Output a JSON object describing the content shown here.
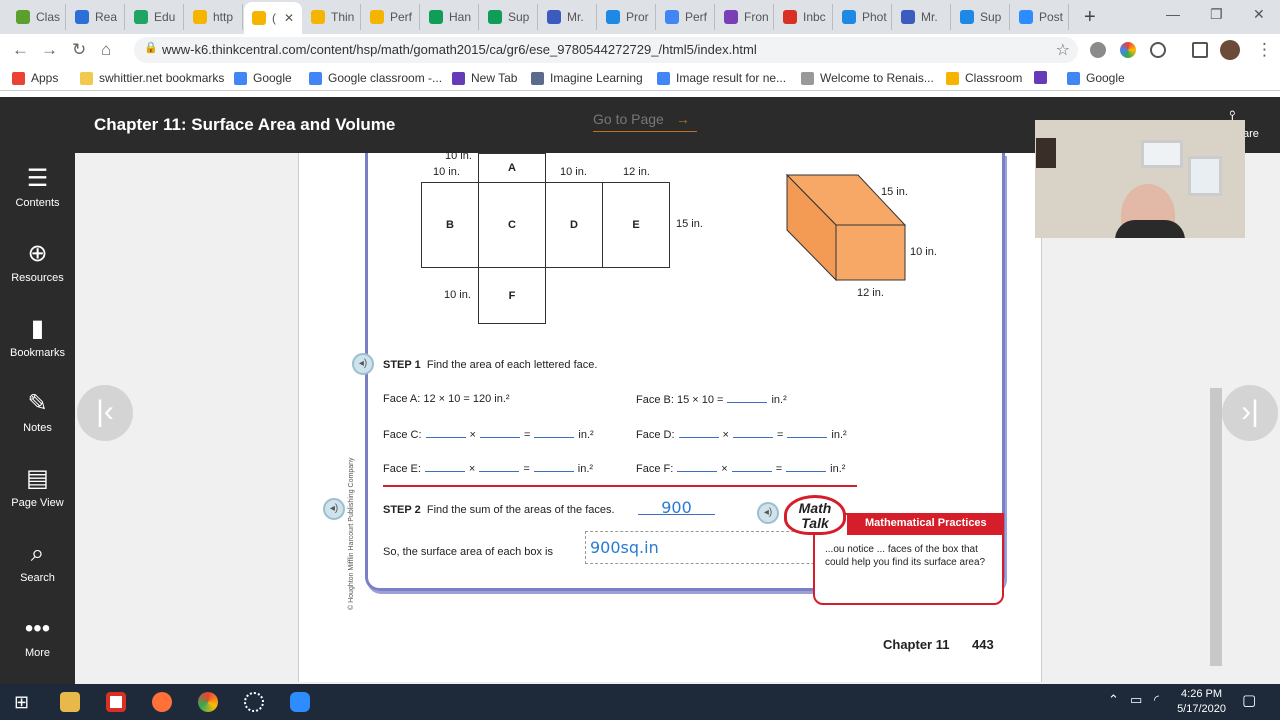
{
  "browser": {
    "tabs": [
      {
        "label": "Clas",
        "color": "#5aa02c"
      },
      {
        "label": "Rea",
        "color": "#2c6fd6"
      },
      {
        "label": "Edu",
        "color": "#1fa463"
      },
      {
        "label": "http",
        "color": "#f4b400"
      },
      {
        "label": "(",
        "color": "#f4b400"
      },
      {
        "label": "Thin",
        "color": "#f4b400"
      },
      {
        "label": "Perf",
        "color": "#f4b400"
      },
      {
        "label": "Han",
        "color": "#0f9d58"
      },
      {
        "label": "Sup",
        "color": "#0f9d58"
      },
      {
        "label": "Mr.",
        "color": "#3b5bbf"
      },
      {
        "label": "Pror",
        "color": "#1e88e5"
      },
      {
        "label": "Perf",
        "color": "#4285f4"
      },
      {
        "label": "Fron",
        "color": "#7b3fb5"
      },
      {
        "label": "Inbc",
        "color": "#d93025"
      },
      {
        "label": "Phot",
        "color": "#1e88e5"
      },
      {
        "label": "Mr.",
        "color": "#3b5bbf"
      },
      {
        "label": "Sup",
        "color": "#1e88e5"
      },
      {
        "label": "Post",
        "color": "#2d8cff"
      }
    ],
    "url": "www-k6.thinkcentral.com/content/hsp/math/gomath2015/ca/gr6/ese_9780544272729_/html5/index.html",
    "bookmarks": [
      {
        "label": "Apps",
        "color": "#ea4335"
      },
      {
        "label": "swhittier.net bookmarks",
        "color": "#f2c94c"
      },
      {
        "label": "Google",
        "color": "#4285f4"
      },
      {
        "label": "Google classroom -...",
        "color": "#4285f4"
      },
      {
        "label": "New Tab",
        "color": "#673ab7"
      },
      {
        "label": "Imagine Learning",
        "color": "#5b6b8c"
      },
      {
        "label": "Image result for ne...",
        "color": "#4285f4"
      },
      {
        "label": "Welcome to Renais...",
        "color": "#999999"
      },
      {
        "label": "Classroom",
        "color": "#f4b400"
      },
      {
        "label": "",
        "color": "#673ab7"
      },
      {
        "label": "Google",
        "color": "#4285f4"
      }
    ]
  },
  "app": {
    "chapter_title": "Chapter 11: Surface Area and Volume",
    "goto_label": "Go to Page",
    "goto_arrow": "→",
    "share_label": "are",
    "nav": [
      {
        "label": "Contents",
        "icon": "list-icon"
      },
      {
        "label": "Resources",
        "icon": "folder-plus-icon"
      },
      {
        "label": "Bookmarks",
        "icon": "book-icon"
      },
      {
        "label": "Notes",
        "icon": "pencil-icon"
      },
      {
        "label": "Page View",
        "icon": "page-view-icon"
      },
      {
        "label": "Search",
        "icon": "search-icon"
      },
      {
        "label": "More",
        "icon": "more-icon"
      }
    ]
  },
  "page": {
    "net": {
      "face_labels": [
        "A",
        "B",
        "C",
        "D",
        "E",
        "F"
      ],
      "dims": {
        "top_a": "10 in.",
        "left_top": "10 in.",
        "d_top": "10 in.",
        "e_top": "12 in.",
        "right": "15 in.",
        "f_left": "10 in."
      }
    },
    "prism": {
      "depth": "15 in.",
      "height": "10 in.",
      "width": "12 in."
    },
    "step1": {
      "label": "STEP 1",
      "text": "Find the area of each lettered face.",
      "face_a": "Face A: 12 × 10 = 120 in.²",
      "face_b_prefix": "Face B: 15 × 10 =",
      "face_c_prefix": "Face C:",
      "face_d_prefix": "Face D:",
      "face_e_prefix": "Face E:",
      "face_f_prefix": "Face F:",
      "times": "×",
      "eq": "=",
      "unit": "in.²"
    },
    "step2": {
      "label": "STEP 2",
      "text": "Find the sum of the areas of the faces.",
      "answer": "900"
    },
    "surface_text": "So, the surface area of each box is",
    "surface_answer": "900sq.in",
    "math_talk": "Math Talk",
    "mp_header": "Mathematical Practices",
    "mp_text": "...ou notice ... faces of the box that could help you find its surface area?",
    "copyright": "© Houghton Mifflin Harcourt Publishing Company",
    "footer_chapter": "Chapter 11",
    "footer_page": "443"
  },
  "taskbar": {
    "time": "4:26 PM",
    "date": "5/17/2020"
  }
}
